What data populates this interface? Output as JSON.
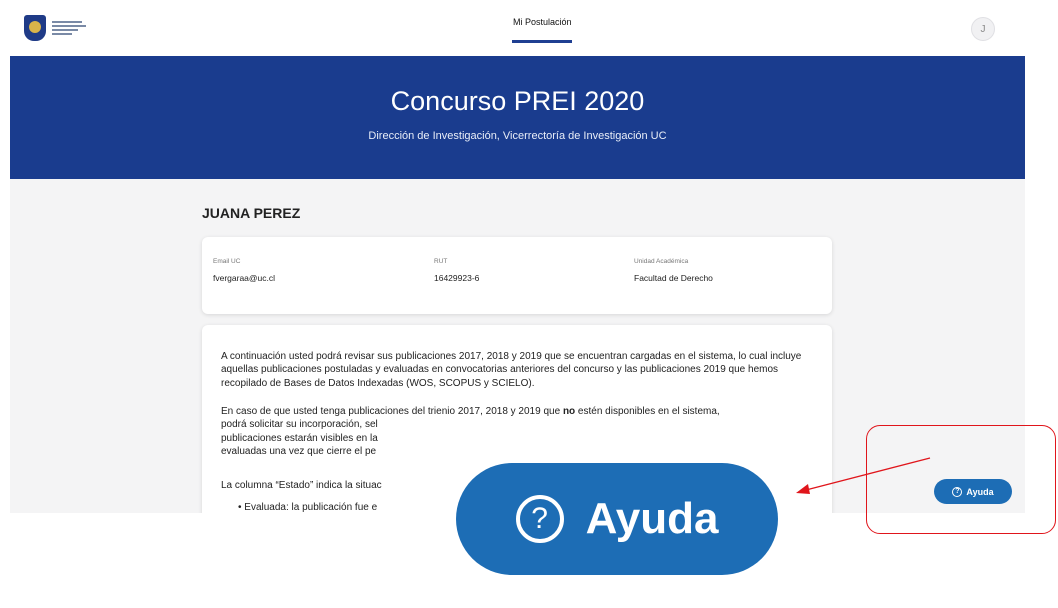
{
  "nav": {
    "tab_label": "Mi Postulación",
    "avatar_initial": "J"
  },
  "hero": {
    "title": "Concurso PREI 2020",
    "subtitle": "Dirección de Investigación, Vicerrectoría de Investigación UC"
  },
  "user": {
    "name": "JUANA PEREZ",
    "fields": [
      {
        "label": "Email UC",
        "value": "fvergaraa@uc.cl"
      },
      {
        "label": "RUT",
        "value": "16429923-6"
      },
      {
        "label": "Unidad Académica",
        "value": "Facultad de Derecho"
      }
    ]
  },
  "instructions": {
    "p1": "A continuación usted podrá revisar sus publicaciones 2017, 2018 y 2019 que se encuentran cargadas en el sistema, lo cual incluye aquellas publicaciones postuladas y evaluadas en convocatorias anteriores del concurso y las publicaciones 2019 que hemos recopilado de Bases de Datos Indexadas (WOS, SCOPUS y SCIELO).",
    "p2_start": "En caso de que usted tenga publicaciones del trienio 2017, 2018 y 2019 que ",
    "p2_bold": "no",
    "p2_end": " estén disponibles en el sistema,",
    "p2_line2": "podrá solicitar su incorporación, sel",
    "p2_line3": "publicaciones estarán visibles en la",
    "p2_line4": "evaluadas una vez que cierre el pe",
    "p3": "La columna “Estado” indica la situac",
    "bullet": "Evaluada: la publicación fue e"
  },
  "help_button": {
    "label": "Ayuda",
    "icon": "question-circle-icon"
  },
  "annotation": {
    "highlight_color": "#e0151b"
  }
}
